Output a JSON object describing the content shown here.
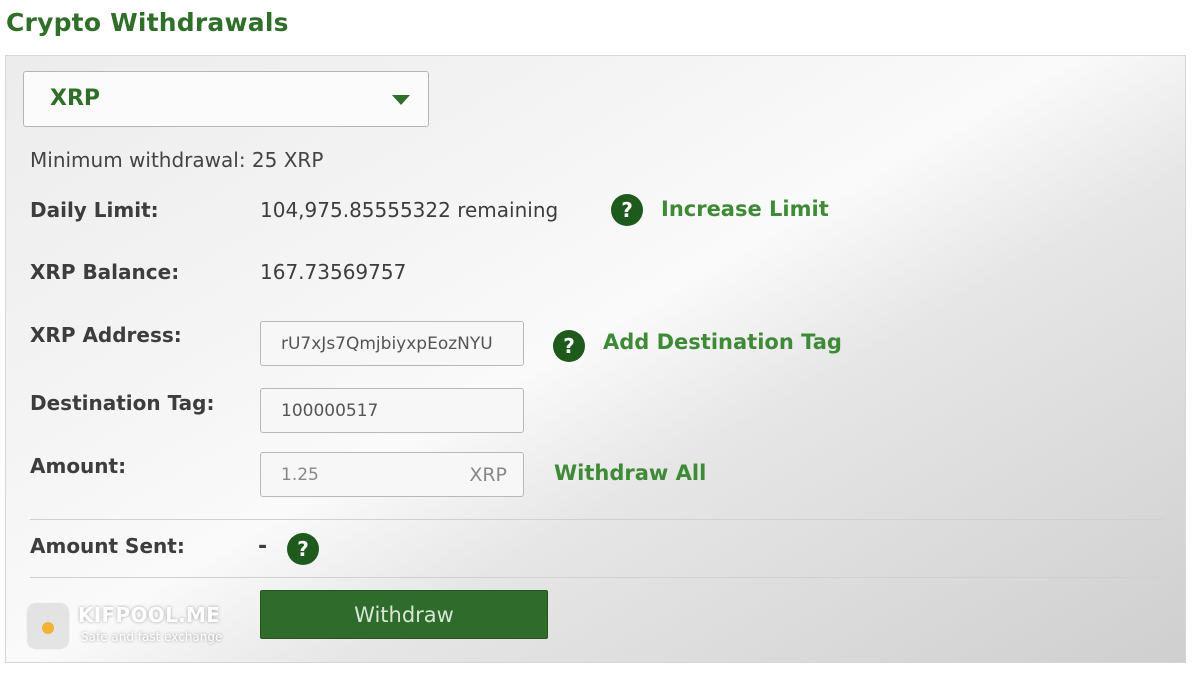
{
  "page": {
    "title": "Crypto Withdrawals"
  },
  "currency": {
    "selected": "XRP"
  },
  "minimum": {
    "text": "Minimum withdrawal: 25 XRP"
  },
  "daily_limit": {
    "label": "Daily Limit:",
    "value": "104,975.85555322 remaining",
    "help": "?",
    "link": "Increase Limit"
  },
  "balance": {
    "label": "XRP Balance:",
    "value": "167.73569757"
  },
  "address": {
    "label": "XRP Address:",
    "value": "rU7xJs7QmjbiyxpEozNYU",
    "help": "?",
    "link": "Add Destination Tag"
  },
  "destination_tag": {
    "label": "Destination Tag:",
    "value": "100000517"
  },
  "amount": {
    "label": "Amount:",
    "value": "1.25",
    "unit": "XRP",
    "link": "Withdraw All"
  },
  "amount_sent": {
    "label": "Amount Sent:",
    "value": "-",
    "help": "?"
  },
  "actions": {
    "withdraw_label": "Withdraw"
  },
  "branding": {
    "name": "KIFPOOL.ME",
    "tagline": "Safe and fast exchange"
  },
  "colors": {
    "accent": "#2f6f2a",
    "link": "#3e8a37",
    "button": "#2f6b2a",
    "help_icon": "#1e5a1c"
  }
}
